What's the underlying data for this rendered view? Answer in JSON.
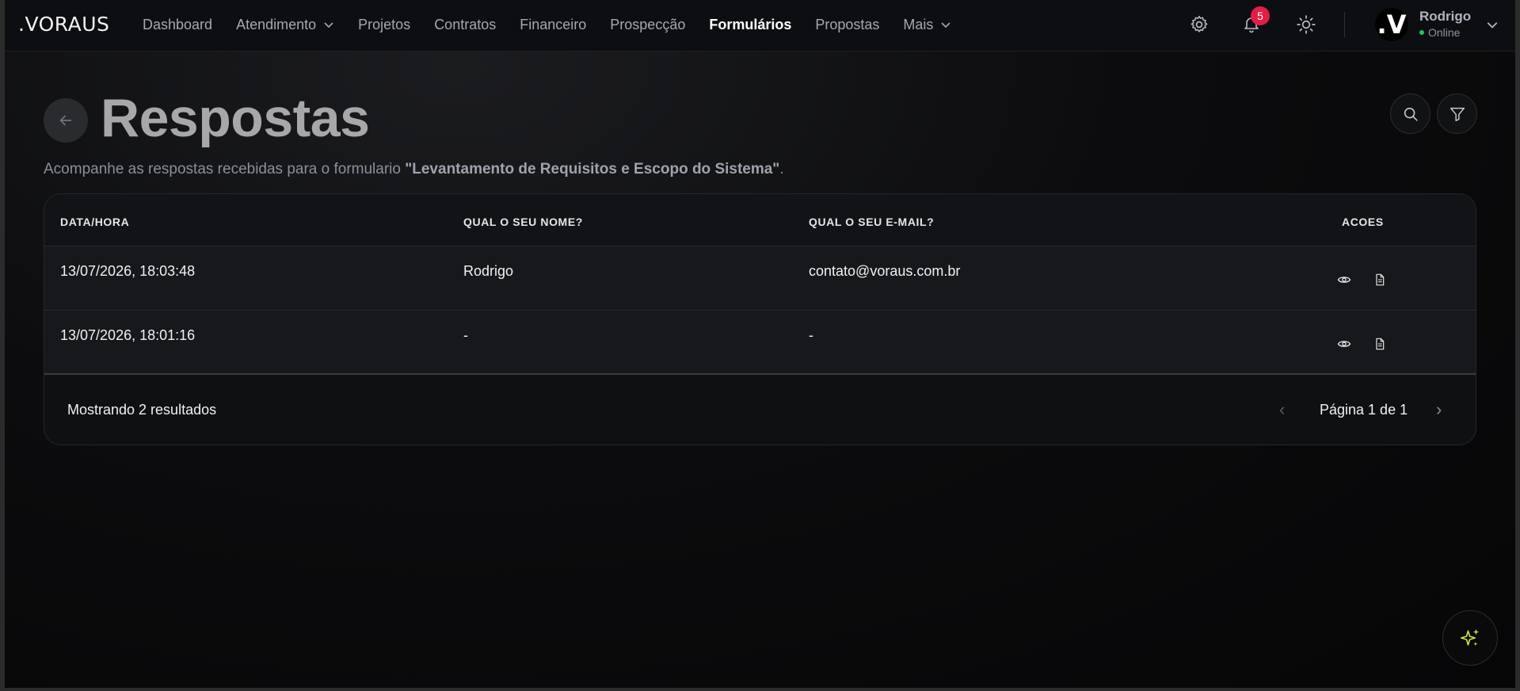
{
  "brand": {
    "logo": ".VORAUS"
  },
  "nav": {
    "items": [
      {
        "label": "Dashboard",
        "dropdown": false,
        "active": false
      },
      {
        "label": "Atendimento",
        "dropdown": true,
        "active": false
      },
      {
        "label": "Projetos",
        "dropdown": false,
        "active": false
      },
      {
        "label": "Contratos",
        "dropdown": false,
        "active": false
      },
      {
        "label": "Financeiro",
        "dropdown": false,
        "active": false
      },
      {
        "label": "Prospecção",
        "dropdown": false,
        "active": false
      },
      {
        "label": "Formulários",
        "dropdown": false,
        "active": true
      },
      {
        "label": "Propostas",
        "dropdown": false,
        "active": false
      },
      {
        "label": "Mais",
        "dropdown": true,
        "active": false
      }
    ],
    "notifications_count": "5",
    "icons": [
      "gear-icon",
      "bell-icon",
      "sun-icon"
    ]
  },
  "user": {
    "avatar_letter": ".V",
    "name": "Rodrigo",
    "status": "Online",
    "status_color": "#22c55e"
  },
  "page": {
    "title": "Respostas",
    "subtitle_prefix": "Acompanhe as respostas recebidas para o formulario ",
    "form_name": "\"Levantamento de Requisitos e Escopo do Sistema\"",
    "subtitle_suffix": "."
  },
  "table": {
    "columns": [
      "DATA/HORA",
      "QUAL O SEU NOME?",
      "QUAL O SEU E-MAIL?",
      "ACOES"
    ],
    "rows": [
      {
        "datetime": "13/07/2026, 18:03:48",
        "name": "Rodrigo",
        "email": "contato@voraus.com.br"
      },
      {
        "datetime": "13/07/2026, 18:01:16",
        "name": "-",
        "email": "-"
      }
    ]
  },
  "footer": {
    "results": "Mostrando 2 resultados",
    "prev": "‹",
    "page_info": "Página 1 de 1",
    "next": "›"
  },
  "colors": {
    "accent_badge": "#e11d48",
    "fab_sparkle": "#c6e84a"
  }
}
